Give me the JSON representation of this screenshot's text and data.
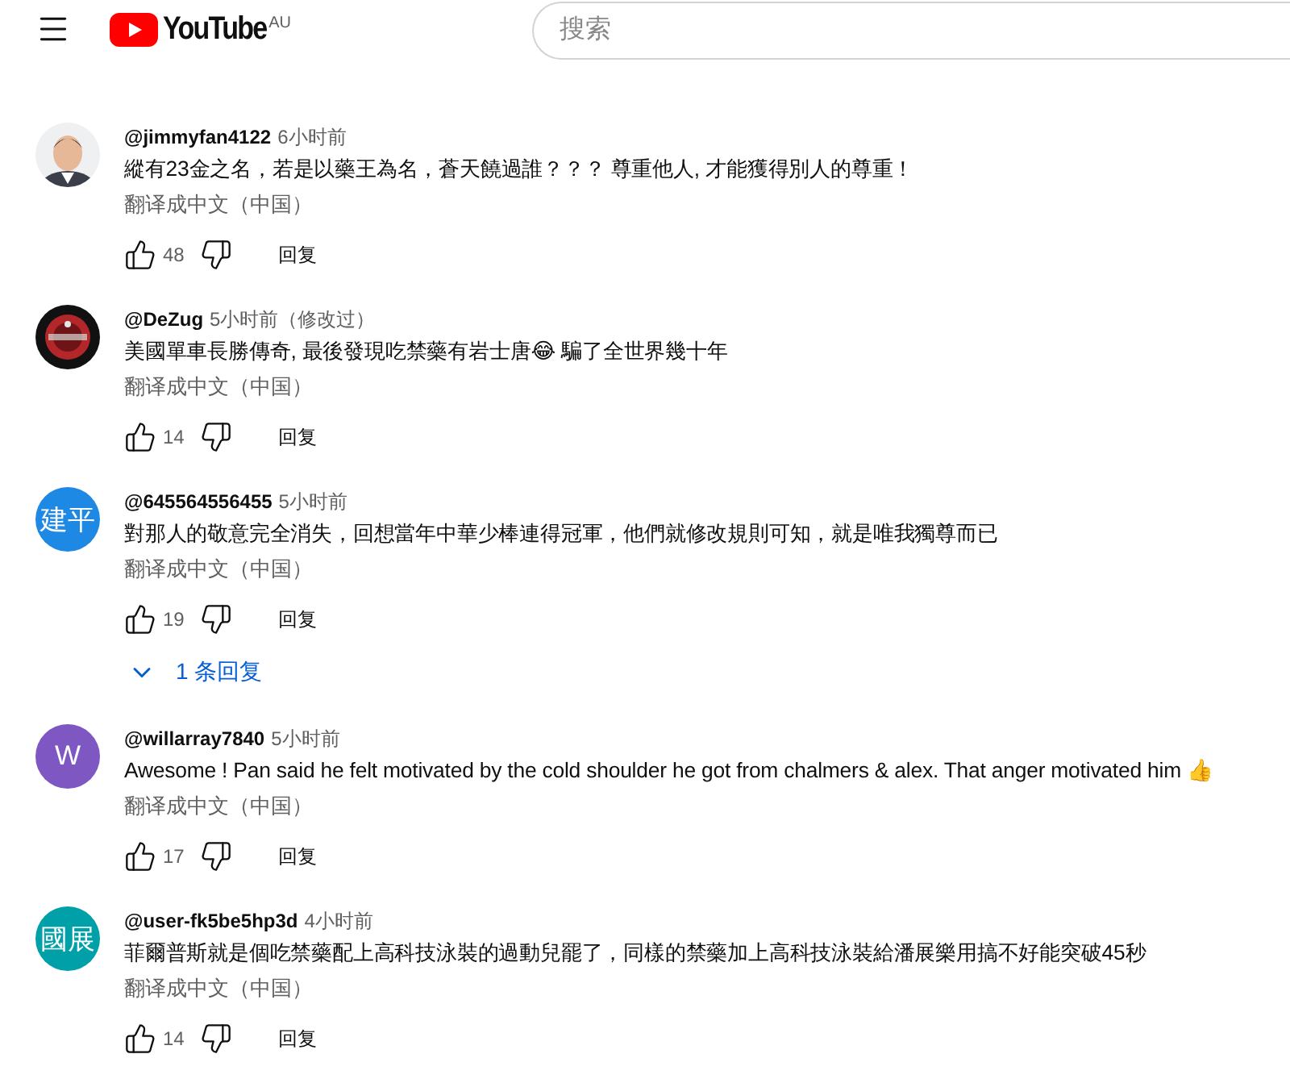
{
  "header": {
    "logo_text": "YouTube",
    "region": "AU",
    "search": {
      "placeholder": "搜索"
    }
  },
  "comments": [
    {
      "author": "@jimmyfan4122",
      "time": "6小时前",
      "text": "縱有23金之名，若是以藥王為名，蒼天饒過誰？？？ 尊重他人, 才能獲得別人的尊重！",
      "translate": "翻译成中文（中国）",
      "likes": "48",
      "reply": "回复"
    },
    {
      "author": "@DeZug",
      "time": "5小时前（修改过）",
      "text": "美國單車長勝傳奇, 最後發現吃禁藥有岩士唐😂 騙了全世界幾十年",
      "translate": "翻译成中文（中国）",
      "likes": "14",
      "reply": "回复"
    },
    {
      "avatar": {
        "kind": "letters",
        "text": "建平",
        "color": "#1e88e5"
      },
      "author": "@645564556455",
      "time": "5小时前",
      "text": "對那人的敬意完全消失，回想當年中華少棒連得冠軍，他們就修改規則可知，就是唯我獨尊而已",
      "translate": "翻译成中文（中国）",
      "likes": "19",
      "reply": "回复",
      "replies": "1 条回复"
    },
    {
      "avatar": {
        "kind": "letters",
        "text": "W",
        "color": "#7e57c2"
      },
      "author": "@willarray7840",
      "time": "5小时前",
      "text": "Awesome ! Pan said he felt motivated by the cold shoulder he got from chalmers & alex. That anger motivated him 👍",
      "translate": "翻译成中文（中国）",
      "likes": "17",
      "reply": "回复"
    },
    {
      "avatar": {
        "kind": "letters",
        "text": "國展",
        "color": "#00a0a8"
      },
      "author": "@user-fk5be5hp3d",
      "time": "4小时前",
      "text": "菲爾普斯就是個吃禁藥配上高科技泳裝的過動兒罷了，同樣的禁藥加上高科技泳裝給潘展樂用搞不好能突破45秒",
      "translate": "翻译成中文（中国）",
      "likes": "14",
      "reply": "回复"
    }
  ]
}
